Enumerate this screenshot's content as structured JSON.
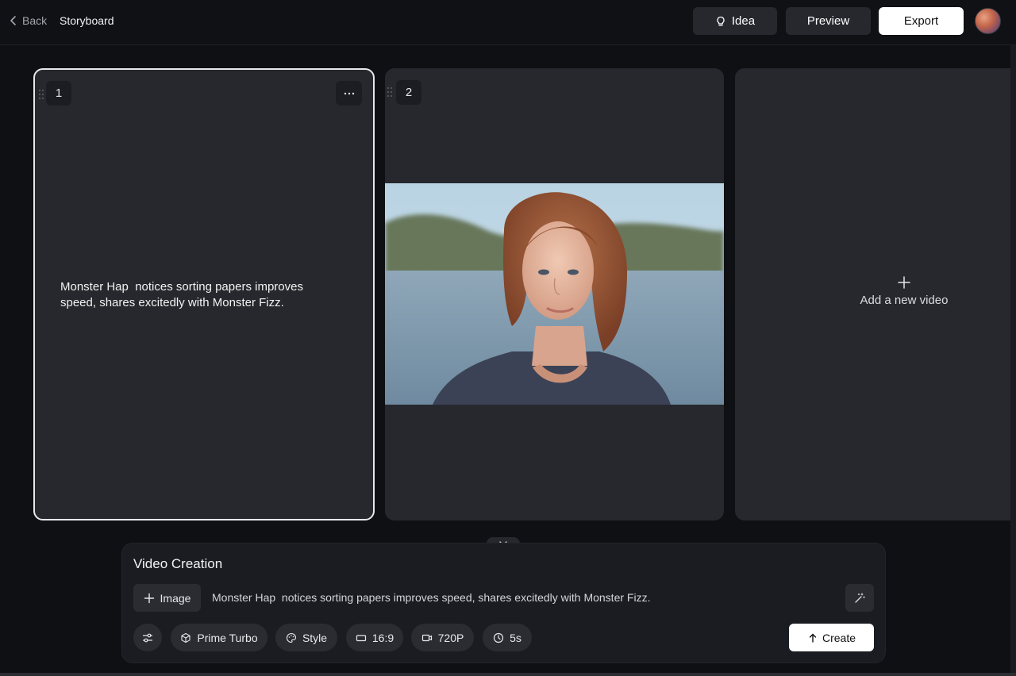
{
  "header": {
    "back_label": "Back",
    "title": "Storyboard",
    "idea_label": "Idea",
    "preview_label": "Preview",
    "export_label": "Export"
  },
  "board": {
    "scenes": [
      {
        "number": "1",
        "text": "Monster Hap  notices sorting papers improves speed, shares excitedly with Monster Fizz."
      },
      {
        "number": "2"
      }
    ],
    "add_label": "Add a new video"
  },
  "creation": {
    "title": "Video Creation",
    "image_label": "Image",
    "prompt": "Monster Hap  notices sorting papers improves speed, shares excitedly with Monster Fizz.",
    "model_label": "Prime Turbo",
    "style_label": "Style",
    "ratio_label": "16:9",
    "resolution_label": "720P",
    "duration_label": "5s",
    "create_label": "Create"
  },
  "icons": [
    "chevron-left-icon",
    "lightbulb-icon",
    "drag-handle-icon",
    "more-icon",
    "plus-icon",
    "chevron-down-icon",
    "magic-wand-icon",
    "sliders-icon",
    "cube-icon",
    "palette-icon",
    "aspect-ratio-icon",
    "video-camera-icon",
    "clock-icon",
    "arrow-up-icon"
  ]
}
